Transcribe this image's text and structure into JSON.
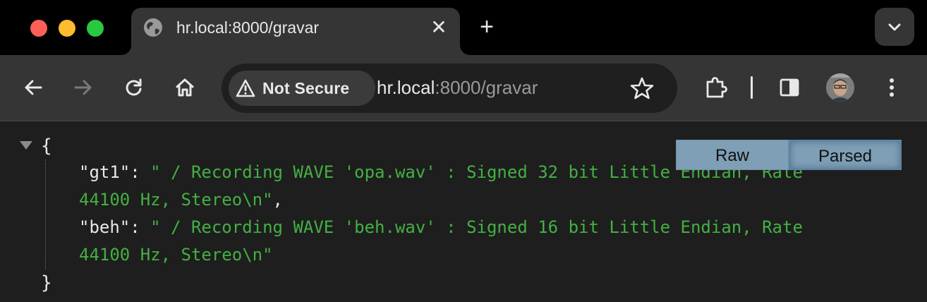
{
  "tab": {
    "title": "hr.local:8000/gravar",
    "close_glyph": "✕"
  },
  "new_tab_glyph": "+",
  "icons": {
    "tab_favicon": "globe-icon",
    "back": "arrow-left-icon",
    "forward": "arrow-right-icon",
    "reload": "reload-icon",
    "home": "home-icon",
    "security": "warning-icon",
    "bookmark": "star-icon",
    "extensions": "puzzle-icon",
    "side_panel": "side-panel-icon",
    "menu": "kebab-menu-icon",
    "tab_search": "chevron-down-icon"
  },
  "omnibox": {
    "security_label": "Not Secure",
    "url_host": "hr.local",
    "url_rest": ":8000/gravar"
  },
  "viewer": {
    "raw_label": "Raw",
    "parsed_label": "Parsed",
    "open_brace": "{",
    "close_brace": "}",
    "entries": [
      {
        "key": "\"gt1\"",
        "colon": ": ",
        "value_line1": "\" / Recording WAVE 'opa.wav' : Signed 32 bit Little Endian, Rate",
        "value_line2": "44100 Hz, Stereo\\n\"",
        "trail": ","
      },
      {
        "key": "\"beh\"",
        "colon": ": ",
        "value_line1": "\" / Recording WAVE 'beh.wav' : Signed 16 bit Little Endian, Rate",
        "value_line2": "44100 Hz, Stereo\\n\"",
        "trail": ""
      }
    ]
  },
  "colors": {
    "json_string": "#43b043",
    "toggle": "#7e9fb6",
    "tab_bg": "#353535",
    "page_bg": "#1e1e1e"
  }
}
